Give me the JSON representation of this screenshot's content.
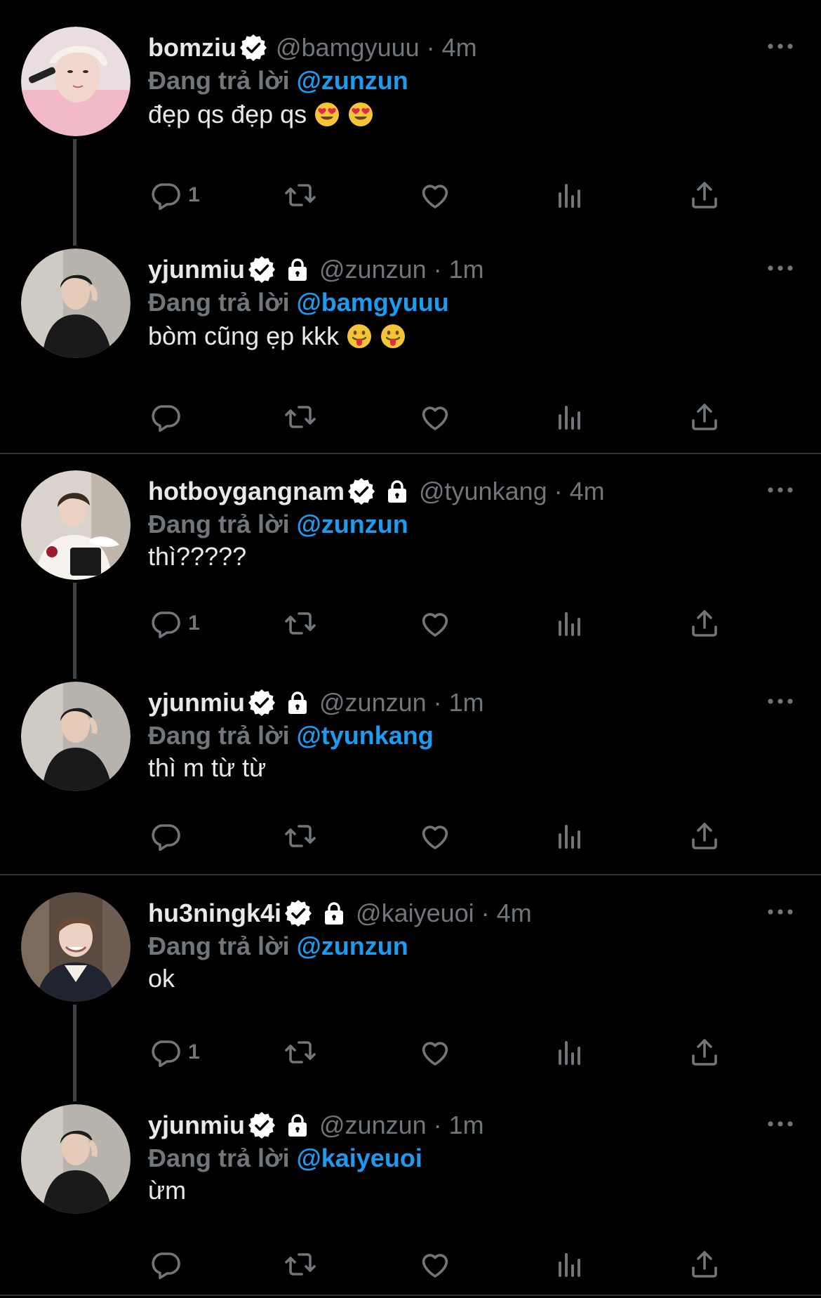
{
  "colors": {
    "background": "#000000",
    "text": "#e7e9ea",
    "muted": "#71767b",
    "accent": "#1d9bf0",
    "thread_line": "#3d4247",
    "separator": "#2f3336"
  },
  "reply_prefix": "Đang trả lời",
  "tweets": [
    {
      "display_name": "bomziu",
      "verified": true,
      "protected": false,
      "handle": "@bamgyuuu",
      "dot": "·",
      "time": "4m",
      "reply_to": "@zunzun",
      "text": "đẹp qs đẹp qs",
      "emoji": [
        "heart-eyes-emoji",
        "heart-eyes-emoji"
      ],
      "reply_count": "1",
      "avatar": "avatar-pink-hoodie"
    },
    {
      "display_name": "yjunmiu",
      "verified": true,
      "protected": true,
      "handle": "@zunzun",
      "dot": "·",
      "time": "1m",
      "reply_to": "@bamgyuuu",
      "text": "bòm cũng ẹp kkk",
      "emoji": [
        "tongue-out-emoji",
        "tongue-out-emoji"
      ],
      "reply_count": "",
      "avatar": "avatar-black-suit"
    },
    {
      "display_name": "hotboygangnam",
      "verified": true,
      "protected": true,
      "handle": "@tyunkang",
      "dot": "·",
      "time": "4m",
      "reply_to": "@zunzun",
      "text": "thì?????",
      "emoji": [],
      "reply_count": "1",
      "avatar": "avatar-white-shirt-rose"
    },
    {
      "display_name": "yjunmiu",
      "verified": true,
      "protected": true,
      "handle": "@zunzun",
      "dot": "·",
      "time": "1m",
      "reply_to": "@tyunkang",
      "text": "thì m từ từ",
      "emoji": [],
      "reply_count": "",
      "avatar": "avatar-black-suit"
    },
    {
      "display_name": "hu3ningk4i",
      "verified": true,
      "protected": true,
      "handle": "@kaiyeuoi",
      "dot": "·",
      "time": "4m",
      "reply_to": "@zunzun",
      "text": "ok",
      "emoji": [],
      "reply_count": "1",
      "avatar": "avatar-smiling-hanbok"
    },
    {
      "display_name": "yjunmiu",
      "verified": true,
      "protected": true,
      "handle": "@zunzun",
      "dot": "·",
      "time": "1m",
      "reply_to": "@kaiyeuoi",
      "text": "ừm",
      "emoji": [],
      "reply_count": "",
      "avatar": "avatar-black-suit"
    }
  ],
  "icons": {
    "reply": "reply-icon",
    "retweet": "retweet-icon",
    "like": "like-icon",
    "views": "views-icon",
    "share": "share-icon",
    "more": "more-icon",
    "verified": "verified-badge-icon",
    "lock": "lock-icon"
  }
}
